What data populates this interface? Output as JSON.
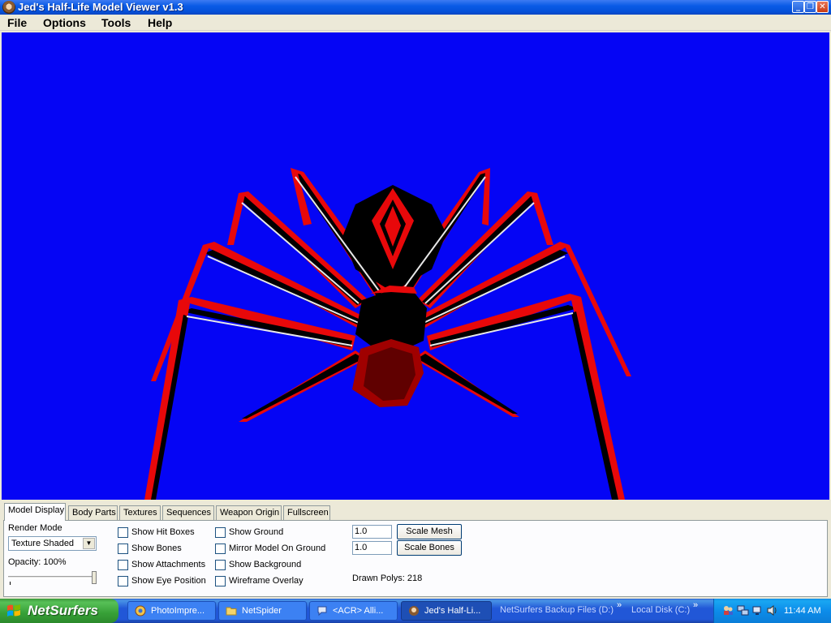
{
  "window": {
    "title": "Jed's Half-Life Model Viewer v1.3"
  },
  "menu": {
    "file": "File",
    "options": "Options",
    "tools": "Tools",
    "help": "Help"
  },
  "viewport": {
    "background_color": "#0505f5",
    "model_colors": {
      "red": "#e8080a",
      "black": "#000000",
      "white": "#e8e8e8"
    }
  },
  "tabs": [
    {
      "label": "Model Display",
      "active": true
    },
    {
      "label": "Body Parts",
      "active": false
    },
    {
      "label": "Textures",
      "active": false
    },
    {
      "label": "Sequences",
      "active": false
    },
    {
      "label": "Weapon Origin",
      "active": false
    },
    {
      "label": "Fullscreen",
      "active": false
    }
  ],
  "model_display": {
    "render_mode_label": "Render Mode",
    "render_mode_value": "Texture Shaded",
    "opacity_label": "Opacity: 100%",
    "opacity_value": 1.0,
    "checkboxes_col1": [
      {
        "label": "Show Hit Boxes",
        "checked": false
      },
      {
        "label": "Show Bones",
        "checked": false
      },
      {
        "label": "Show Attachments",
        "checked": false
      },
      {
        "label": "Show Eye Position",
        "checked": false
      }
    ],
    "checkboxes_col2": [
      {
        "label": "Show Ground",
        "checked": false
      },
      {
        "label": "Mirror Model On Ground",
        "checked": false
      },
      {
        "label": "Show Background",
        "checked": false
      },
      {
        "label": "Wireframe Overlay",
        "checked": false
      }
    ],
    "scale_mesh_value": "1.0",
    "scale_mesh_button": "Scale Mesh",
    "scale_bones_value": "1.0",
    "scale_bones_button": "Scale Bones",
    "drawn_polys": "Drawn Polys: 218"
  },
  "taskbar": {
    "start_label": "NetSurfers",
    "tasks": [
      {
        "label": "PhotoImpre...",
        "icon": "photoimpression-icon",
        "active": false
      },
      {
        "label": "NetSpider",
        "icon": "folder-icon",
        "active": false
      },
      {
        "label": "<ACR> Alli...",
        "icon": "chat-icon",
        "active": false
      },
      {
        "label": "Jed's Half-Li...",
        "icon": "model-viewer-icon",
        "active": true
      }
    ],
    "toolbars": [
      {
        "label": "NetSurfers Backup Files (D:)"
      },
      {
        "label": "Local Disk (C:)"
      }
    ],
    "clock": "11:44 AM"
  }
}
